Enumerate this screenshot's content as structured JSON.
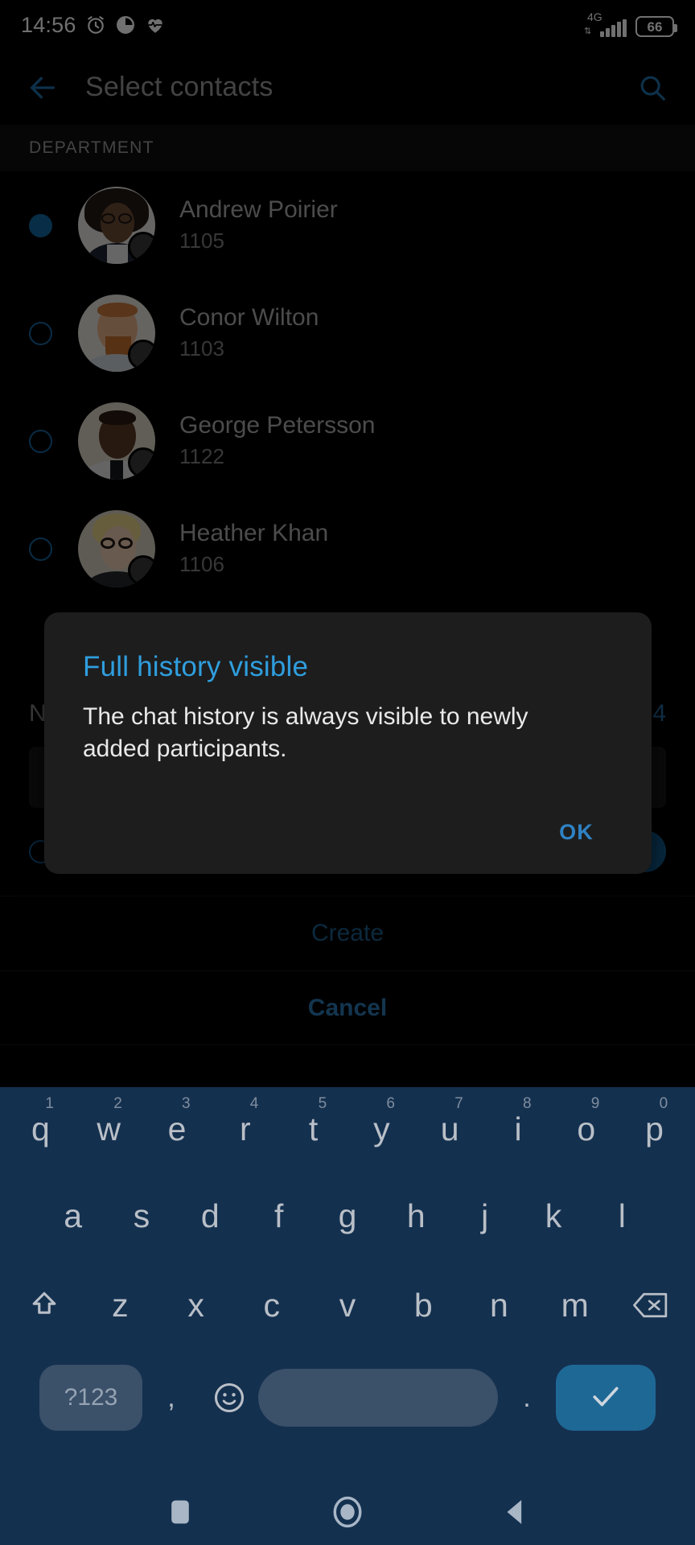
{
  "status_bar": {
    "time": "14:56",
    "alarm_icon": "alarm-icon",
    "app_icon_1": "circle-app-icon",
    "app_icon_2": "heartbeat-icon",
    "network_type": "4G",
    "signal_bars": 4,
    "battery_percent": "66"
  },
  "app_bar": {
    "back_icon": "back-arrow-icon",
    "title": "Select contacts",
    "search_icon": "search-icon"
  },
  "section": {
    "header": "DEPARTMENT"
  },
  "contacts": [
    {
      "name": "Andrew Poirier",
      "extension": "1105",
      "selected": true
    },
    {
      "name": "Conor Wilton",
      "extension": "1103",
      "selected": false
    },
    {
      "name": "George Petersson",
      "extension": "1122",
      "selected": false
    },
    {
      "name": "Heather Khan",
      "extension": "1106",
      "selected": false
    }
  ],
  "form": {
    "label": "N",
    "counter": "4"
  },
  "dialog": {
    "title": "Full history visible",
    "message": "The chat history is always visible to newly added participants.",
    "ok_label": "OK"
  },
  "actions": {
    "create_label": "Create",
    "cancel_label": "Cancel"
  },
  "keyboard": {
    "row1": [
      {
        "letter": "q",
        "num": "1"
      },
      {
        "letter": "w",
        "num": "2"
      },
      {
        "letter": "e",
        "num": "3"
      },
      {
        "letter": "r",
        "num": "4"
      },
      {
        "letter": "t",
        "num": "5"
      },
      {
        "letter": "y",
        "num": "6"
      },
      {
        "letter": "u",
        "num": "7"
      },
      {
        "letter": "i",
        "num": "8"
      },
      {
        "letter": "o",
        "num": "9"
      },
      {
        "letter": "p",
        "num": "0"
      }
    ],
    "row2": [
      "a",
      "s",
      "d",
      "f",
      "g",
      "h",
      "j",
      "k",
      "l"
    ],
    "row3": [
      "z",
      "x",
      "c",
      "v",
      "b",
      "n",
      "m"
    ],
    "shift_icon": "shift-up-icon",
    "backspace_icon": "backspace-icon",
    "symbols_label": "?123",
    "comma": ",",
    "emoji_icon": "emoji-smiley-icon",
    "space_label": "",
    "period": ".",
    "enter_icon": "check-enter-icon"
  },
  "nav_bar": {
    "recents_icon": "square-recents-icon",
    "home_icon": "circle-home-icon",
    "back_icon": "triangle-back-icon"
  },
  "colors": {
    "accent": "#2f9ede",
    "accent_dim": "#2f82c4",
    "keyboard_bg": "#14304f",
    "dialog_bg": "#1d1d1d",
    "page_bg": "#000000"
  }
}
